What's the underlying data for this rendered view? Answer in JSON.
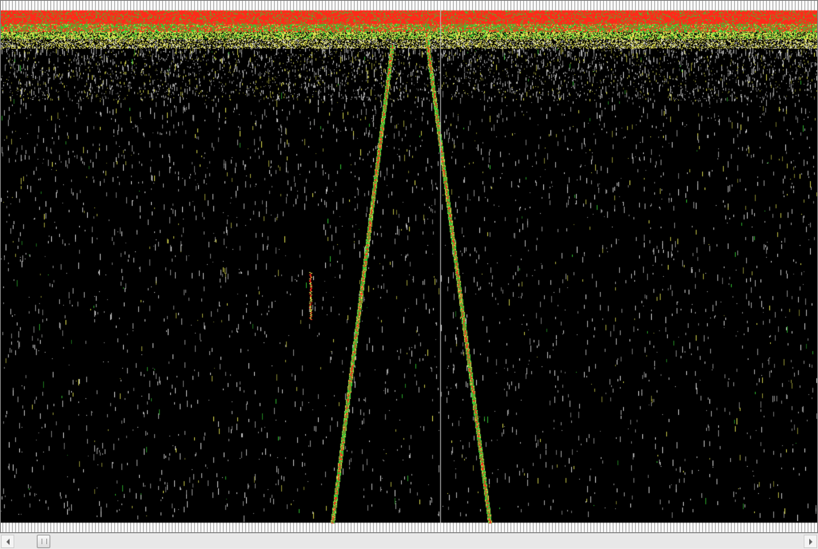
{
  "view": {
    "background": "#000000",
    "palette": {
      "low": "#d8d8d8",
      "mid_low": "#e0e050",
      "mid": "#33cc33",
      "high": "#ff2a1a",
      "border": "#7f7f7f",
      "ruler_tick": "#9a9a9a"
    },
    "selection_line_color": "#bdbdbd"
  },
  "scrollbar": {
    "position_fraction": 0.02,
    "left_icon": "chevron-left-icon",
    "right_icon": "chevron-right-icon"
  }
}
